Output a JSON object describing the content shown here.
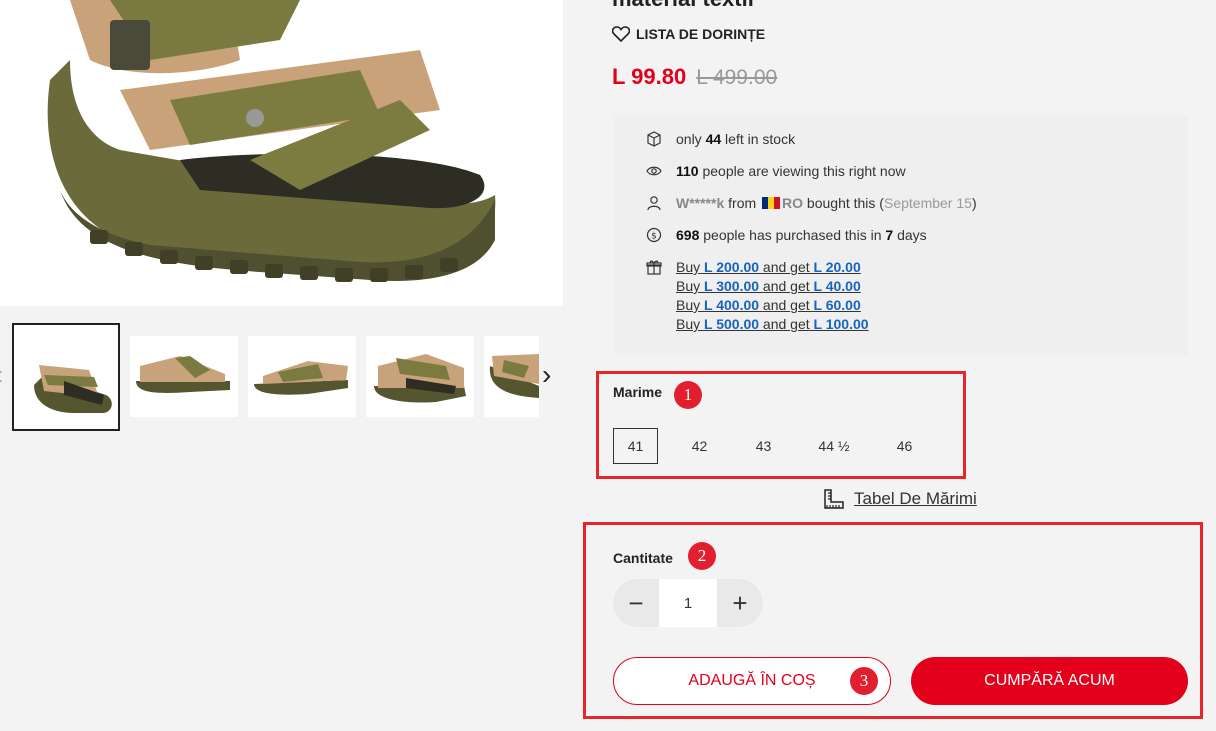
{
  "product": {
    "title_fragment": "material textil",
    "wishlist_label": "LISTA DE DORINȚE",
    "price_current": "L 99.80",
    "price_old": "L 499.00"
  },
  "info": {
    "stock": {
      "pre": "only",
      "count": "44",
      "post": "left in stock"
    },
    "viewing": {
      "count": "110",
      "post": "people are viewing this right now"
    },
    "recent": {
      "user": "W*****k",
      "from": "from",
      "country": "RO",
      "action": "bought this",
      "date": "September 15"
    },
    "purchased": {
      "count": "698",
      "mid": "people has purchased this in",
      "days": "7",
      "post": "days"
    },
    "promos": [
      {
        "buy": "Buy",
        "amount": "L 200.00",
        "get": "and get",
        "reward": "L 20.00"
      },
      {
        "buy": "Buy",
        "amount": "L 300.00",
        "get": "and get",
        "reward": "L 40.00"
      },
      {
        "buy": "Buy",
        "amount": "L 400.00",
        "get": "and get",
        "reward": "L 60.00"
      },
      {
        "buy": "Buy",
        "amount": "L 500.00",
        "get": "and get",
        "reward": "L 100.00"
      }
    ]
  },
  "size": {
    "label": "Marime",
    "options": [
      "41",
      "42",
      "43",
      "44 ½",
      "46"
    ],
    "selected": "41",
    "chart_link": "Tabel De Mărimi"
  },
  "quantity": {
    "label": "Cantitate",
    "value": "1",
    "minus": "−",
    "plus": "+"
  },
  "actions": {
    "add_to_cart": "ADAUGĂ ÎN COȘ",
    "buy_now": "CUMPĂRĂ ACUM"
  },
  "annotations": [
    "1",
    "2",
    "3"
  ],
  "colors": {
    "accent": "#e2001a",
    "link": "#1565c0",
    "highlight": "#e8262a"
  }
}
